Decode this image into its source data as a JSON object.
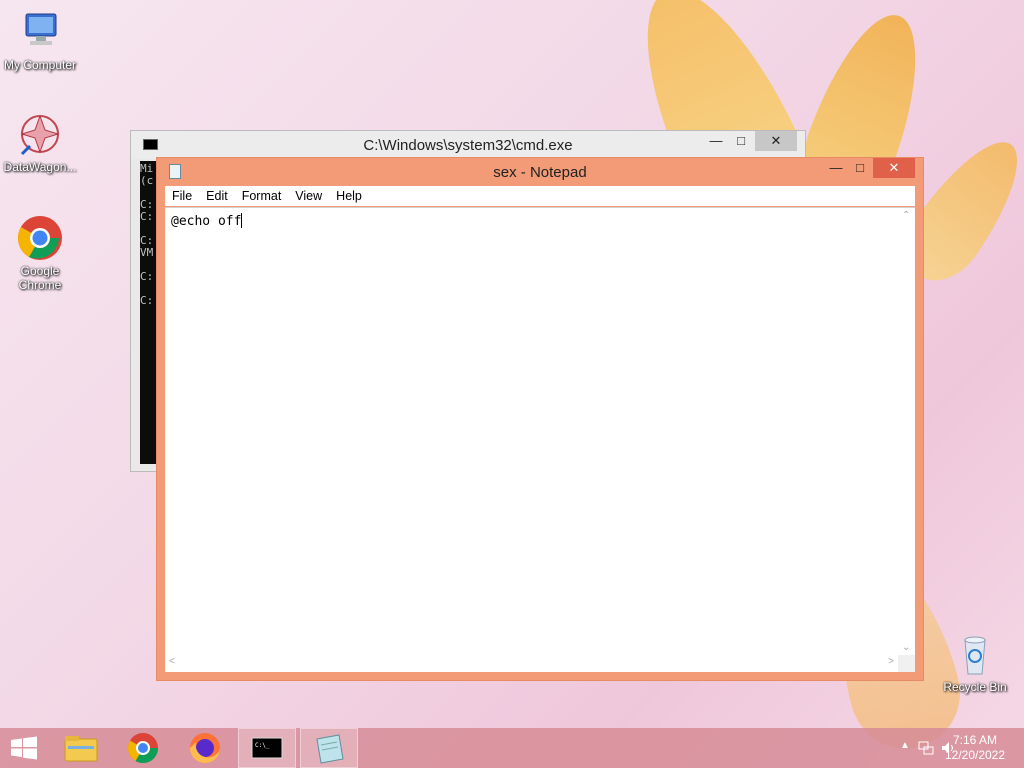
{
  "desktop": {
    "icons": [
      {
        "label": "My Computer"
      },
      {
        "label": "DataWagon..."
      },
      {
        "label": "Google Chrome"
      },
      {
        "label": "Recycle Bin"
      }
    ]
  },
  "cmd_window": {
    "title": "C:\\Windows\\system32\\cmd.exe",
    "console_lines": "Mi\n(c\n\nC:\nC:\n\nC:\nVM\n\nC:\n\nC:"
  },
  "notepad_window": {
    "title": "sex - Notepad",
    "menu": [
      "File",
      "Edit",
      "Format",
      "View",
      "Help"
    ],
    "content": "@echo off"
  },
  "taskbar": {
    "items": [
      "start-button",
      "file-explorer",
      "google-chrome",
      "firefox",
      "cmd",
      "notepad"
    ],
    "clock_time": "7:16 AM",
    "clock_date": "12/20/2022"
  },
  "colors": {
    "notepad_accent": "#f29b76",
    "taskbar": "#d68c96"
  }
}
